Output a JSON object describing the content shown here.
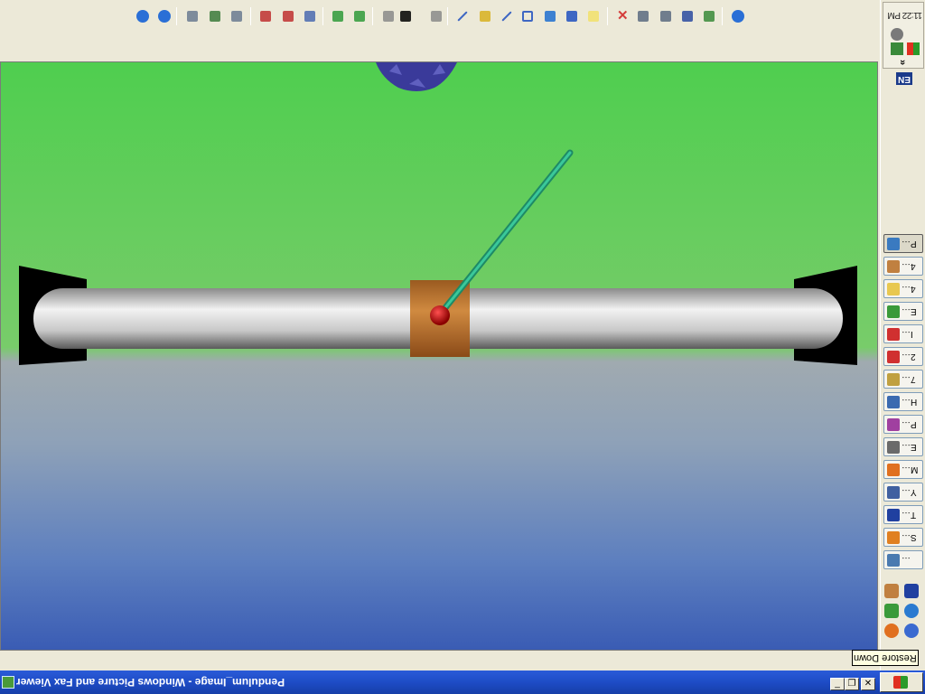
{
  "window": {
    "title": "Pendulum_Image - Windows Picture and Fax Viewer",
    "tooltip": "Restore Down",
    "buttons": {
      "minimize": "_",
      "restore": "❐",
      "close": "✕"
    }
  },
  "toolbar": {
    "buttons": [
      {
        "name": "previous-image",
        "icon": "previous-icon",
        "color": "#2a6fd6"
      },
      {
        "name": "next-image",
        "icon": "next-icon",
        "color": "#2a6fd6"
      },
      {
        "name": "best-fit",
        "icon": "best-fit-icon",
        "color": "#6a7a90"
      },
      {
        "name": "actual-size",
        "icon": "actual-size-icon",
        "color": "#3b7a3b"
      },
      {
        "name": "slideshow",
        "icon": "slideshow-icon",
        "color": "#6a7a90"
      },
      {
        "name": "zoom-in",
        "icon": "zoom-in-icon",
        "color": "#c03030"
      },
      {
        "name": "zoom-out",
        "icon": "zoom-out-icon",
        "color": "#c03030"
      },
      {
        "name": "magnifier",
        "icon": "magnifier-icon",
        "color": "#4a6ab0"
      },
      {
        "name": "rotate-clockwise",
        "icon": "rotate-cw-icon",
        "color": "#2f9a3a"
      },
      {
        "name": "rotate-counterclockwise",
        "icon": "rotate-ccw-icon",
        "color": "#2f9a3a"
      },
      {
        "name": "previous-page",
        "icon": "prev-page-icon",
        "color": "#8a8a8a"
      },
      {
        "name": "page-number",
        "icon": "page-number-icon",
        "color": "#000000"
      },
      {
        "name": "next-page",
        "icon": "next-page-icon",
        "color": "#8a8a8a"
      },
      {
        "name": "freehand-annotation",
        "icon": "freehand-icon",
        "color": "#2050c0"
      },
      {
        "name": "highlighter",
        "icon": "highlighter-icon",
        "color": "#d8b020"
      },
      {
        "name": "straight-line",
        "icon": "line-icon",
        "color": "#2050c0"
      },
      {
        "name": "frame",
        "icon": "rectangle-icon",
        "color": "#2050c0"
      },
      {
        "name": "filled-rectangle",
        "icon": "filled-rectangle-icon",
        "color": "#1f6fd0"
      },
      {
        "name": "text-annotation",
        "icon": "text-icon",
        "color": "#2050c0"
      },
      {
        "name": "note",
        "icon": "note-icon",
        "color": "#f2e06a"
      },
      {
        "name": "delete",
        "icon": "delete-icon",
        "color": "#d02020"
      },
      {
        "name": "print",
        "icon": "print-icon",
        "color": "#5a6a80"
      },
      {
        "name": "copy-to",
        "icon": "copy-to-icon",
        "color": "#5a6a80"
      },
      {
        "name": "save",
        "icon": "save-icon",
        "color": "#2a4aa0"
      },
      {
        "name": "edit",
        "icon": "edit-icon",
        "color": "#3a8a3a"
      },
      {
        "name": "help",
        "icon": "help-icon",
        "color": "#2a6fd6"
      }
    ]
  },
  "tray": {
    "clock": "11:22 PM",
    "expand": "»",
    "language": "EN"
  },
  "taskbar": {
    "buttons": [
      {
        "label": "P…",
        "icon": "picture-viewer-icon",
        "color": "#3a7ac0",
        "active": true
      },
      {
        "label": "4…",
        "icon": "folder-icon",
        "color": "#c08040"
      },
      {
        "label": "4…",
        "icon": "folder-icon",
        "color": "#e8c850"
      },
      {
        "label": "E…",
        "icon": "excel-icon",
        "color": "#3a9a3a"
      },
      {
        "label": "I…",
        "icon": "acrobat-icon",
        "color": "#d03030"
      },
      {
        "label": "2…",
        "icon": "acrobat-icon",
        "color": "#d03030"
      },
      {
        "label": "7…",
        "icon": "tool-icon",
        "color": "#c0a040"
      },
      {
        "label": "H…",
        "icon": "window-icon",
        "color": "#3a6ab0"
      },
      {
        "label": "P…",
        "icon": "paint-icon",
        "color": "#a040a0"
      },
      {
        "label": "E…",
        "icon": "editor-icon",
        "color": "#6a6a6a"
      },
      {
        "label": "M…",
        "icon": "matlab-icon",
        "color": "#e07020"
      },
      {
        "label": "Y…",
        "icon": "app-icon",
        "color": "#4060a0"
      },
      {
        "label": "T…",
        "icon": "disk-icon",
        "color": "#2040a0"
      },
      {
        "label": "S…",
        "icon": "browser-icon",
        "color": "#e08020"
      },
      {
        "label": "…",
        "icon": "tool-icon",
        "color": "#4a7ab0"
      }
    ]
  },
  "quick_launch": {
    "icons": [
      {
        "name": "tools-icon",
        "color": "#c08040"
      },
      {
        "name": "save-disk-icon",
        "color": "#2040a0"
      },
      {
        "name": "excel-icon",
        "color": "#3a9a3a"
      },
      {
        "name": "ie-icon",
        "color": "#2a7ad0"
      },
      {
        "name": "firefox-icon",
        "color": "#e07020"
      },
      {
        "name": "globe-icon",
        "color": "#3a6ad0"
      }
    ]
  },
  "colors": {
    "sky_top": "#4fce4f",
    "floor_bottom": "#3a5cb4",
    "rail": "#d8d8d8",
    "cart": "#c47a30",
    "pivot": "#c00000",
    "pendulum_rod": "#2aaa80",
    "supports": "#000000",
    "gear": "#3a3a9a"
  }
}
